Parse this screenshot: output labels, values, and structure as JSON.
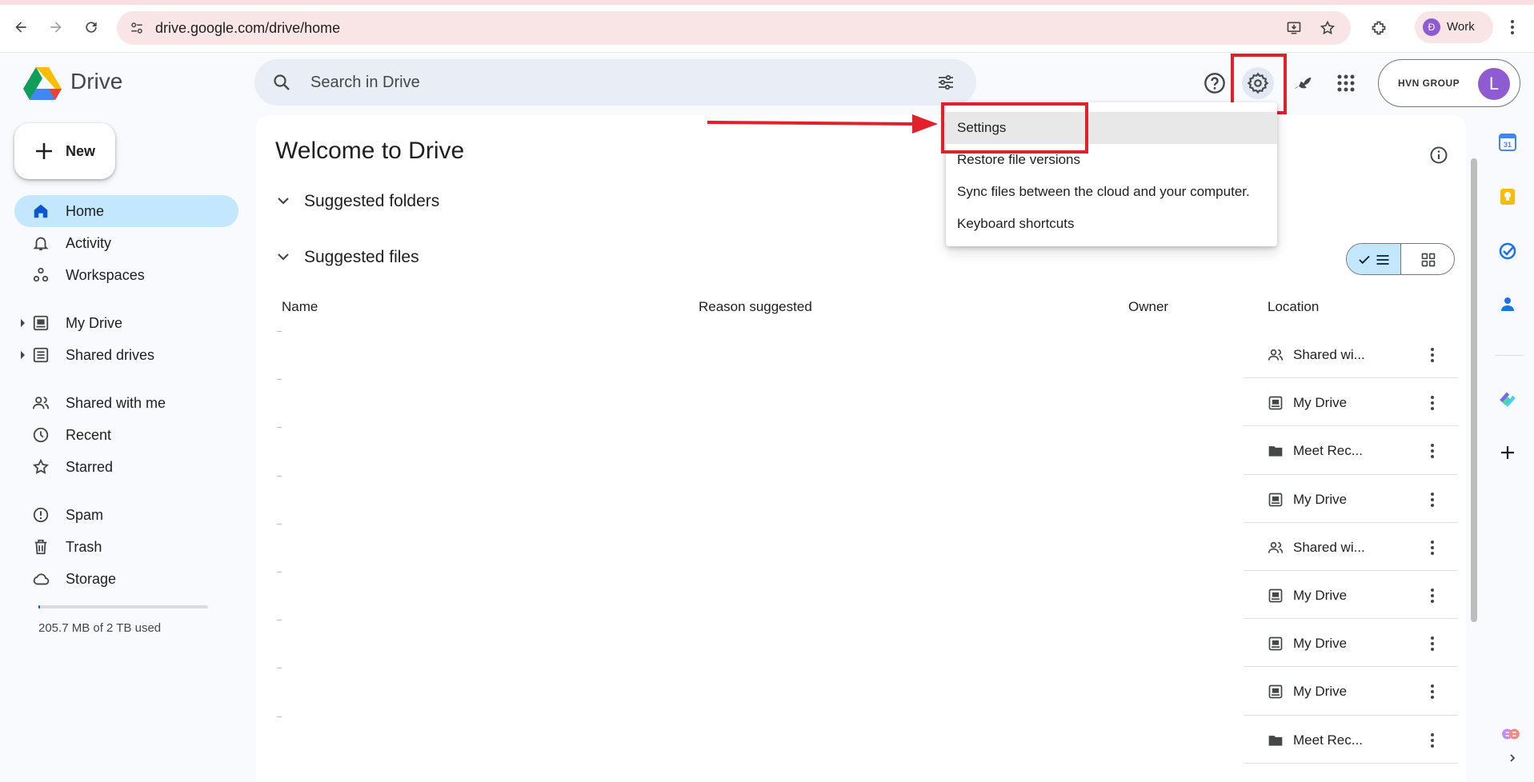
{
  "browser": {
    "url": "drive.google.com/drive/home",
    "profile_initial": "Đ",
    "profile_label": "Work"
  },
  "app": {
    "name": "Drive",
    "search_placeholder": "Search in Drive",
    "account_org": "HVN GROUP",
    "account_initial": "L"
  },
  "sidebar": {
    "new_label": "New",
    "items": [
      {
        "label": "Home",
        "icon": "home-icon",
        "active": true
      },
      {
        "label": "Activity",
        "icon": "bell-icon"
      },
      {
        "label": "Workspaces",
        "icon": "workspaces-icon"
      },
      {
        "label": "My Drive",
        "icon": "my-drive-icon",
        "expandable": true
      },
      {
        "label": "Shared drives",
        "icon": "shared-drives-icon",
        "expandable": true
      },
      {
        "label": "Shared with me",
        "icon": "people-icon"
      },
      {
        "label": "Recent",
        "icon": "clock-icon"
      },
      {
        "label": "Starred",
        "icon": "star-icon"
      },
      {
        "label": "Spam",
        "icon": "spam-icon"
      },
      {
        "label": "Trash",
        "icon": "trash-icon"
      },
      {
        "label": "Storage",
        "icon": "cloud-icon"
      }
    ],
    "storage_text": "205.7 MB of 2 TB used",
    "storage_fraction": 0.0001
  },
  "main": {
    "title": "Welcome to Drive",
    "sections": [
      "Suggested folders",
      "Suggested files"
    ],
    "columns": [
      "Name",
      "Reason suggested",
      "Owner",
      "Location"
    ],
    "rows": [
      {
        "location": "Shared wi...",
        "icon": "people-icon"
      },
      {
        "location": "My Drive",
        "icon": "my-drive-icon"
      },
      {
        "location": "Meet Rec...",
        "icon": "folder-icon"
      },
      {
        "location": "My Drive",
        "icon": "my-drive-icon"
      },
      {
        "location": "Shared wi...",
        "icon": "people-icon"
      },
      {
        "location": "My Drive",
        "icon": "my-drive-icon"
      },
      {
        "location": "My Drive",
        "icon": "my-drive-icon"
      },
      {
        "location": "My Drive",
        "icon": "my-drive-icon"
      },
      {
        "location": "Meet Rec...",
        "icon": "folder-icon"
      }
    ]
  },
  "settings_menu": {
    "items": [
      "Settings",
      "Restore file versions",
      "Sync files between the cloud and your computer.",
      "Keyboard shortcuts"
    ]
  },
  "colors": {
    "accent": "#0b57d0",
    "active_nav": "#c2e7ff",
    "highlight": "#e0202b",
    "avatar": "#8e5bd2"
  }
}
